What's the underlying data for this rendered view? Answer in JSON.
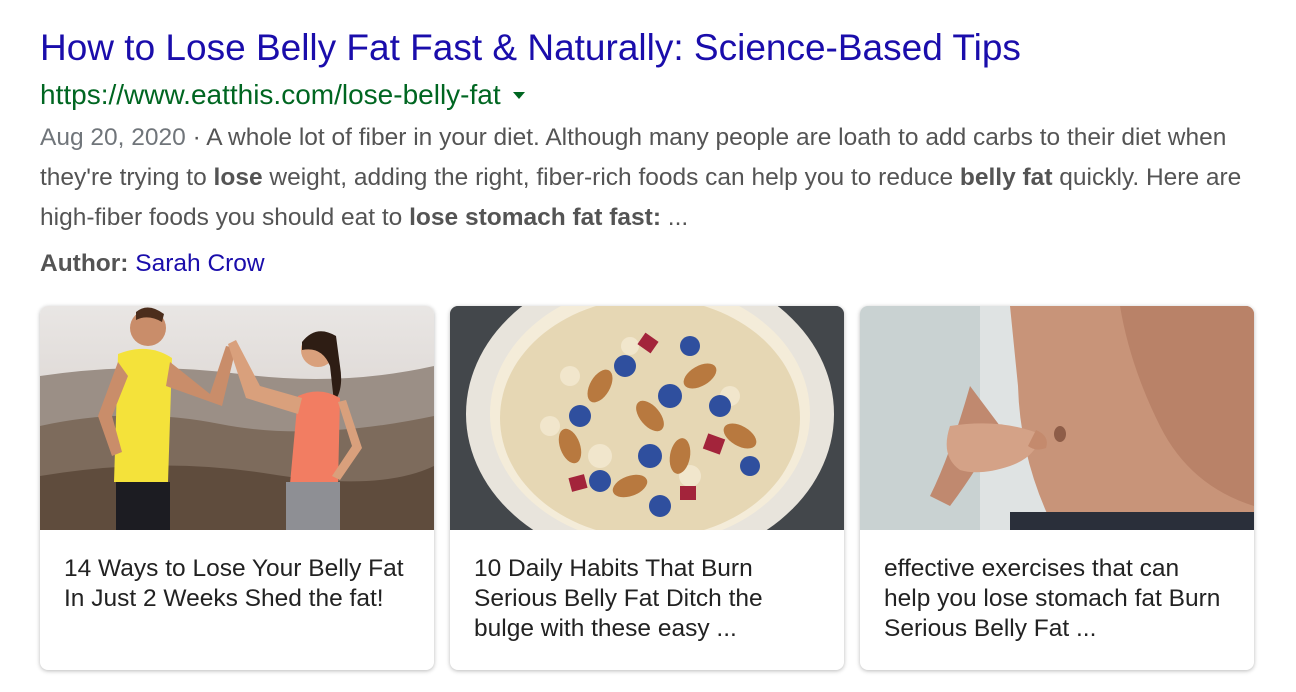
{
  "result": {
    "title": "How to Lose Belly Fat Fast & Naturally: Science-Based Tips",
    "url": "https://www.eatthis.com/lose-belly-fat",
    "date": "Aug 20, 2020",
    "separator": " · ",
    "snippet_parts": [
      {
        "text": "A whole lot of fiber in your diet. Although many people are loath to add carbs to their diet when they're trying to ",
        "bold": false
      },
      {
        "text": "lose",
        "bold": true
      },
      {
        "text": " weight, adding the right, fiber-rich foods can help you to reduce ",
        "bold": false
      },
      {
        "text": "belly fat",
        "bold": true
      },
      {
        "text": " quickly. Here are high-fiber foods you should eat to ",
        "bold": false
      },
      {
        "text": "lose stomach fat fast:",
        "bold": true
      },
      {
        "text": " ...",
        "bold": false
      }
    ],
    "author_label": "Author:",
    "author_name": "Sarah Crow"
  },
  "cards": [
    {
      "text": "14 Ways to Lose Your Belly Fat In Just 2 Weeks Shed the fat!",
      "image": "couple-high-five-photo"
    },
    {
      "text": "10 Daily Habits That Burn Serious Belly Fat Ditch the bulge with these easy ...",
      "image": "oatmeal-bowl-photo"
    },
    {
      "text": "effective exercises that can help you lose stomach fat Burn Serious Belly Fat ...",
      "image": "pinched-belly-photo"
    }
  ],
  "colors": {
    "title_link": "#1a0dab",
    "url_green": "#006621",
    "snippet_gray": "#545454"
  }
}
